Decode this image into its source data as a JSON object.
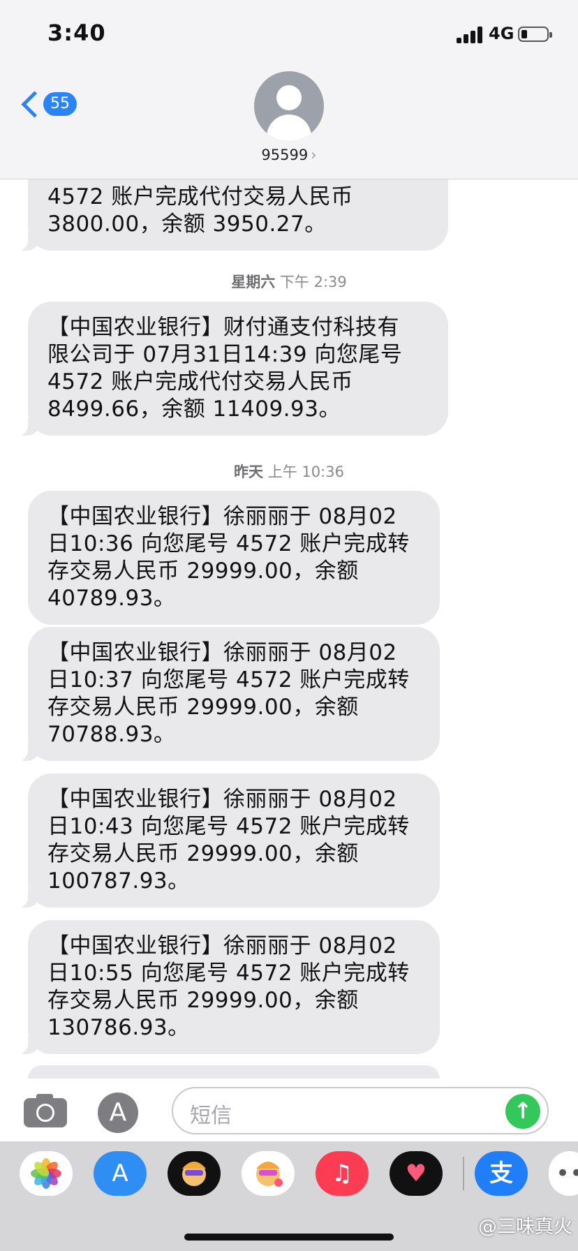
{
  "status_bar": {
    "time": "3:40",
    "network": "4G"
  },
  "nav": {
    "back_count": "55",
    "contact": "95599",
    "contact_arrow": "›"
  },
  "messages": [
    {
      "text": "4572 账户完成代付交易人民币\n3800.00，余额 3950.27。"
    },
    {
      "text": "【中国农业银行】财付通支付科技有\n限公司于 07月31日14:39 向您尾号\n4572 账户完成代付交易人民币\n8499.66，余额 11409.93。"
    },
    {
      "text": "【中国农业银行】徐丽丽于 08月02\n日10:36 向您尾号 4572 账户完成转\n存交易人民币 29999.00，余额\n40789.93。"
    },
    {
      "text": "【中国农业银行】徐丽丽于 08月02\n日10:37 向您尾号 4572 账户完成转\n存交易人民币 29999.00，余额\n70788.93。"
    },
    {
      "text": "【中国农业银行】徐丽丽于 08月02\n日10:43 向您尾号 4572 账户完成转\n存交易人民币 29999.00，余额\n100787.93。"
    },
    {
      "text": "【中国农业银行】徐丽丽于 08月02\n日10:55 向您尾号 4572 账户完成转\n存交易人民币 29999.00，余额\n130786.93。"
    }
  ],
  "timestamps": [
    {
      "day": "星期六",
      "time": "下午 2:39"
    },
    {
      "day": "昨天",
      "time": "上午 10:36"
    }
  ],
  "input": {
    "placeholder": "短信",
    "send_glyph": "↑",
    "appstore_glyph": "A"
  },
  "drawer": {
    "apps": [
      "photos-icon",
      "app-store-icon",
      "memoji-icon",
      "memoji-stickers-icon",
      "music-icon",
      "heart-app-icon",
      "alipay-icon",
      "more-icon"
    ],
    "store_glyph": "A",
    "music_glyph": "♫",
    "heart_glyph": "♥",
    "alipay_glyph": "支",
    "more_glyph": "••",
    "watermark": "@三味真火"
  },
  "colors": {
    "accent": "#2a84f5",
    "bubble": "#e9e9eb",
    "send": "#34c759"
  }
}
